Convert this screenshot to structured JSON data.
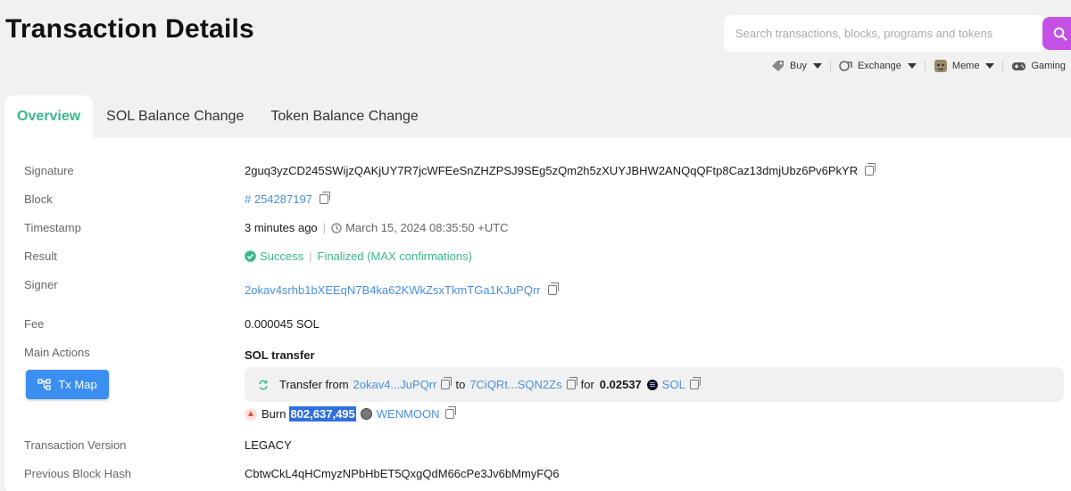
{
  "page_title": "Transaction Details",
  "search": {
    "placeholder": "Search transactions, blocks, programs and tokens"
  },
  "nav": {
    "items": [
      {
        "label": "Buy",
        "icon": "tag-icon"
      },
      {
        "label": "Exchange",
        "icon": "exchange-icon"
      },
      {
        "label": "Meme",
        "icon": "doge-icon"
      },
      {
        "label": "Gaming",
        "icon": "gamepad-icon"
      }
    ]
  },
  "tabs": [
    {
      "label": "Overview",
      "active": true
    },
    {
      "label": "SOL Balance Change",
      "active": false
    },
    {
      "label": "Token Balance Change",
      "active": false
    }
  ],
  "details": {
    "signature_label": "Signature",
    "signature": "2guq3yzCD245SWijzQAKjUY7R7jcWFEeSnZHZPSJ9SEg5zQm2h5zXUYJBHW2ANQqQFtp8Caz13dmjUbz6Pv6PkYR",
    "block_label": "Block",
    "block": "# 254287197",
    "timestamp_label": "Timestamp",
    "timestamp_relative": "3 minutes ago",
    "timestamp_absolute": "March 15, 2024 08:35:50 +UTC",
    "result_label": "Result",
    "result_status": "Success",
    "result_finality": "Finalized (MAX confirmations)",
    "signer_label": "Signer",
    "signer": "2okav4srhb1bXEEqN7B4ka62KWkZsxTkmTGa1KJuPQrr",
    "fee_label": "Fee",
    "fee": "0.000045 SOL",
    "main_actions_label": "Main Actions",
    "tx_map_label": "Tx Map",
    "action_title": "SOL transfer",
    "transfer": {
      "prefix": "Transfer from",
      "from": "2okav4...JuPQrr",
      "to_word": "to",
      "to": "7CiQRt...SQN2Zs",
      "for_word": "for",
      "amount": "0.02537",
      "token": "SOL"
    },
    "burn": {
      "label": "Burn",
      "amount": "802,637,495",
      "token": "WENMOON"
    },
    "version_label": "Transaction Version",
    "version": "LEGACY",
    "prev_hash_label": "Previous Block Hash",
    "prev_hash": "CbtwCkL4qHCmyzNPbHbET5QxgQdM66cPe3Jv6bMmyFQ6"
  },
  "colors": {
    "accent_green": "#3bb78f",
    "link_blue": "#4a8fe0",
    "search_button": "#c450e6",
    "tx_map_button": "#3b8ff0"
  }
}
